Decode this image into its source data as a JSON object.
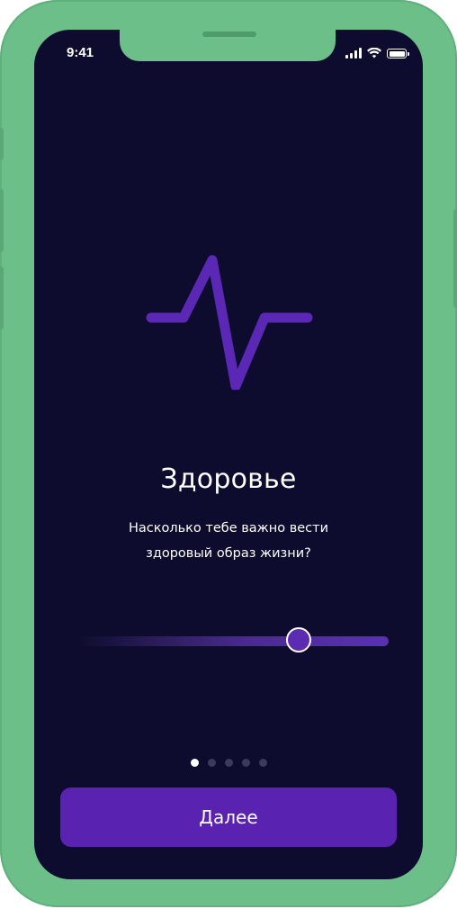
{
  "status_bar": {
    "time": "9:41",
    "icons": [
      "signal-icon",
      "wifi-icon",
      "battery-icon"
    ]
  },
  "content": {
    "icon": "pulse-icon",
    "title": "Здоровье",
    "subtitle_line1": "Насколько тебе важно вести",
    "subtitle_line2": "здоровый образ жизни?"
  },
  "slider": {
    "value_fraction": 0.71
  },
  "pagination": {
    "total": 5,
    "active_index": 0
  },
  "next_button": {
    "label": "Далее"
  },
  "colors": {
    "frame": "#6dbf8a",
    "background": "#0e0c2e",
    "accent": "#5a22b0",
    "text": "#ffffff"
  }
}
